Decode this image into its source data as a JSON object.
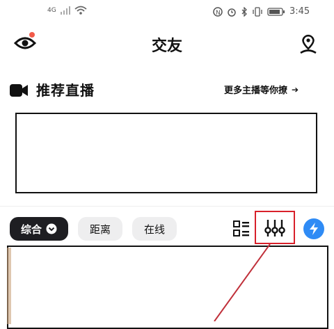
{
  "status_bar": {
    "network": "4G",
    "time": "3:45"
  },
  "header": {
    "title": "交友"
  },
  "recommend": {
    "title": "推荐直播",
    "more_label": "更多主播等你撩",
    "more_arrow": "➔"
  },
  "filters": {
    "general_label": "综合",
    "distance_label": "距离",
    "online_label": "在线"
  },
  "colors": {
    "accent_blue": "#2f8bf5",
    "notification_red": "#f25b4a",
    "highlight_red": "#d8202a",
    "chip_dark": "#1e1e22",
    "chip_light": "#eeeeef"
  },
  "icons": {
    "eye": "eye-icon",
    "location": "location-pin-icon",
    "video": "video-camera-icon",
    "grid": "grid-list-icon",
    "filter": "filter-sliders-icon",
    "flash": "lightning-icon",
    "dropdown": "chevron-down-circle-icon"
  }
}
